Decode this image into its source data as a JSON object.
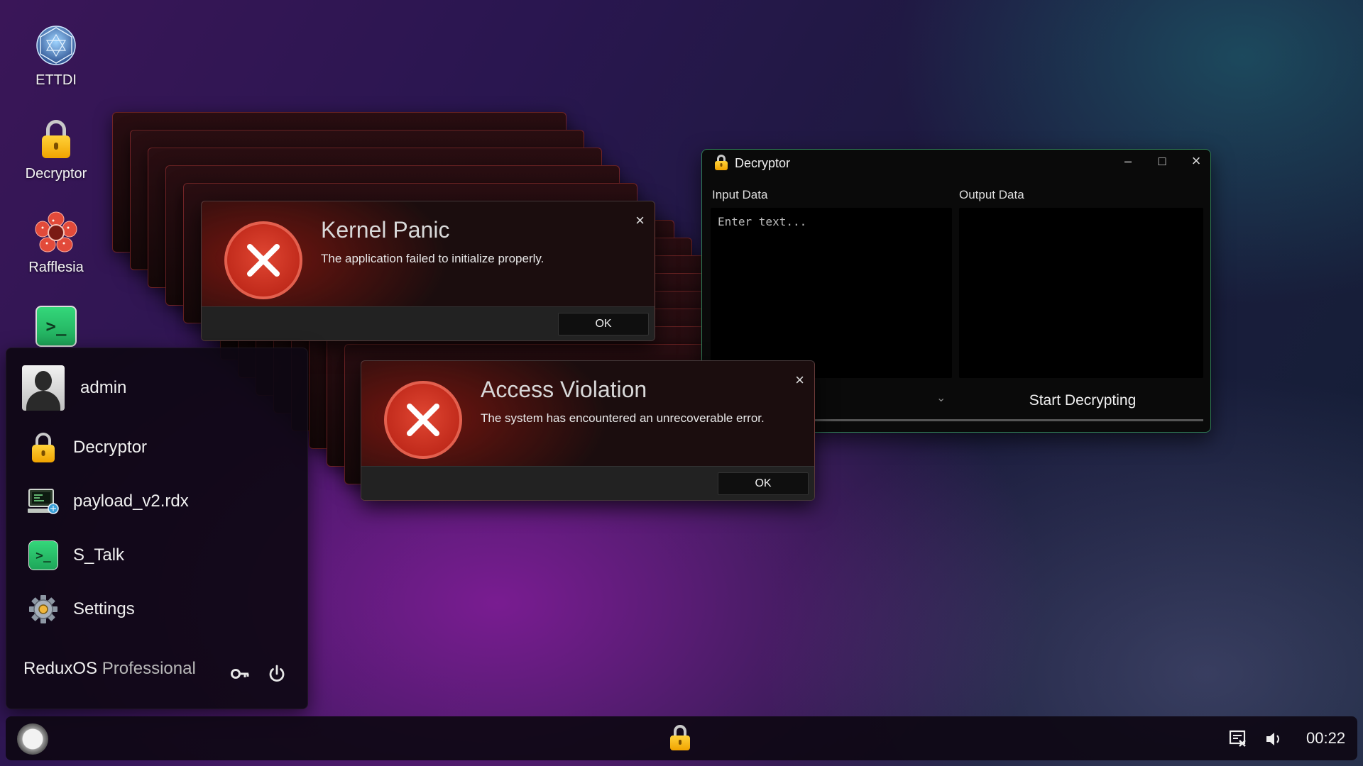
{
  "desktop": {
    "icons": [
      {
        "label": "ETTDI",
        "icon": "sphere-icon"
      },
      {
        "label": "Decryptor",
        "icon": "lock-icon"
      },
      {
        "label": "Rafflesia",
        "icon": "flower-icon"
      },
      {
        "label": "",
        "icon": "terminal-icon"
      }
    ]
  },
  "dialogs": [
    {
      "title": "Kernel Panic",
      "message": "The application failed to initialize properly.",
      "ok_label": "OK",
      "close_glyph": "×"
    },
    {
      "title": "Access Violation",
      "message": "The system has encountered an unrecoverable error.",
      "ok_label": "OK",
      "close_glyph": "×"
    }
  ],
  "decryptor": {
    "title": "Decryptor",
    "input_label": "Input Data",
    "output_label": "Output Data",
    "input_placeholder": "Enter text...",
    "action_label": "Start Decrypting",
    "minimize_glyph": "–",
    "maximize_glyph": "□",
    "close_glyph": "×",
    "border_color": "#3ddc8c"
  },
  "start_menu": {
    "user": "admin",
    "items": [
      {
        "label": "Decryptor",
        "icon": "lock-icon"
      },
      {
        "label": "payload_v2.rdx",
        "icon": "computer-file-icon"
      },
      {
        "label": "S_Talk",
        "icon": "terminal-icon"
      },
      {
        "label": "Settings",
        "icon": "gear-icon"
      }
    ],
    "brand_name": "ReduxOS",
    "brand_edition": "Professional"
  },
  "taskbar": {
    "clock": "00:22"
  },
  "colors": {
    "error_red": "#c8281a",
    "accent_green": "#3ddc8c",
    "lock_gold": "#f5b50a"
  }
}
